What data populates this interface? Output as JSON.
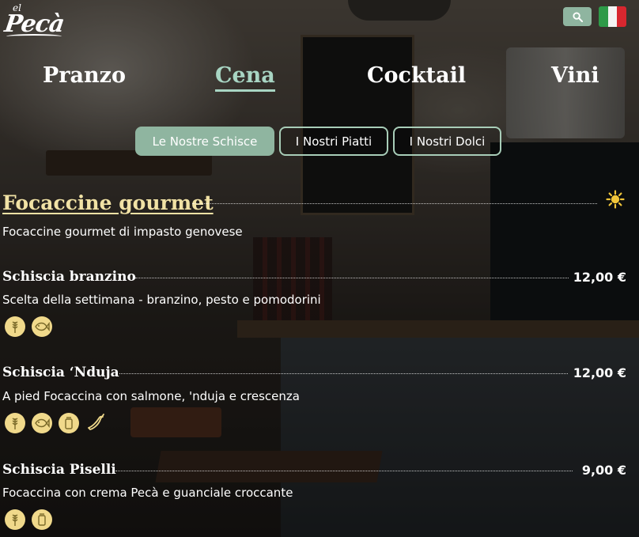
{
  "brand": {
    "logo_small": "el",
    "logo_main": "Pecà"
  },
  "header": {
    "search_icon": "search-icon",
    "language_icon": "italian-flag-icon"
  },
  "main_nav": [
    {
      "label": "Pranzo",
      "active": false
    },
    {
      "label": "Cena",
      "active": true
    },
    {
      "label": "Cocktail",
      "active": false
    },
    {
      "label": "Vini",
      "active": false
    }
  ],
  "sub_tabs": [
    {
      "label": "Le Nostre Schisce",
      "active": true
    },
    {
      "label": "I Nostri Piatti",
      "active": false
    },
    {
      "label": "I Nostri Dolci",
      "active": false
    }
  ],
  "category": {
    "title": "Focaccine gourmet",
    "icon": "sun-icon",
    "description": "Focaccine gourmet di impasto genovese"
  },
  "items": [
    {
      "name": "Schiscia branzino",
      "price": "12,00 €",
      "description": "Scelta della settimana - branzino, pesto e pomodorini",
      "allergens": [
        "gluten-icon",
        "fish-icon"
      ]
    },
    {
      "name": "Schiscia ‘Nduja",
      "price": "12,00 €",
      "description": "A pied Focaccina con salmone, 'nduja e crescenza",
      "allergens": [
        "gluten-icon",
        "fish-icon",
        "dairy-icon",
        "spicy-pepper-icon"
      ]
    },
    {
      "name": "Schiscia Piselli",
      "price": "9,00 €",
      "description": "Focaccina con crema Pecà e guanciale croccante",
      "allergens": [
        "gluten-icon",
        "dairy-icon"
      ]
    }
  ],
  "colors": {
    "accent": "#8fb5a0",
    "active_nav": "#a8d5c3",
    "category_title": "#f1e2a5",
    "allergen_badge": "#f0d98b"
  }
}
